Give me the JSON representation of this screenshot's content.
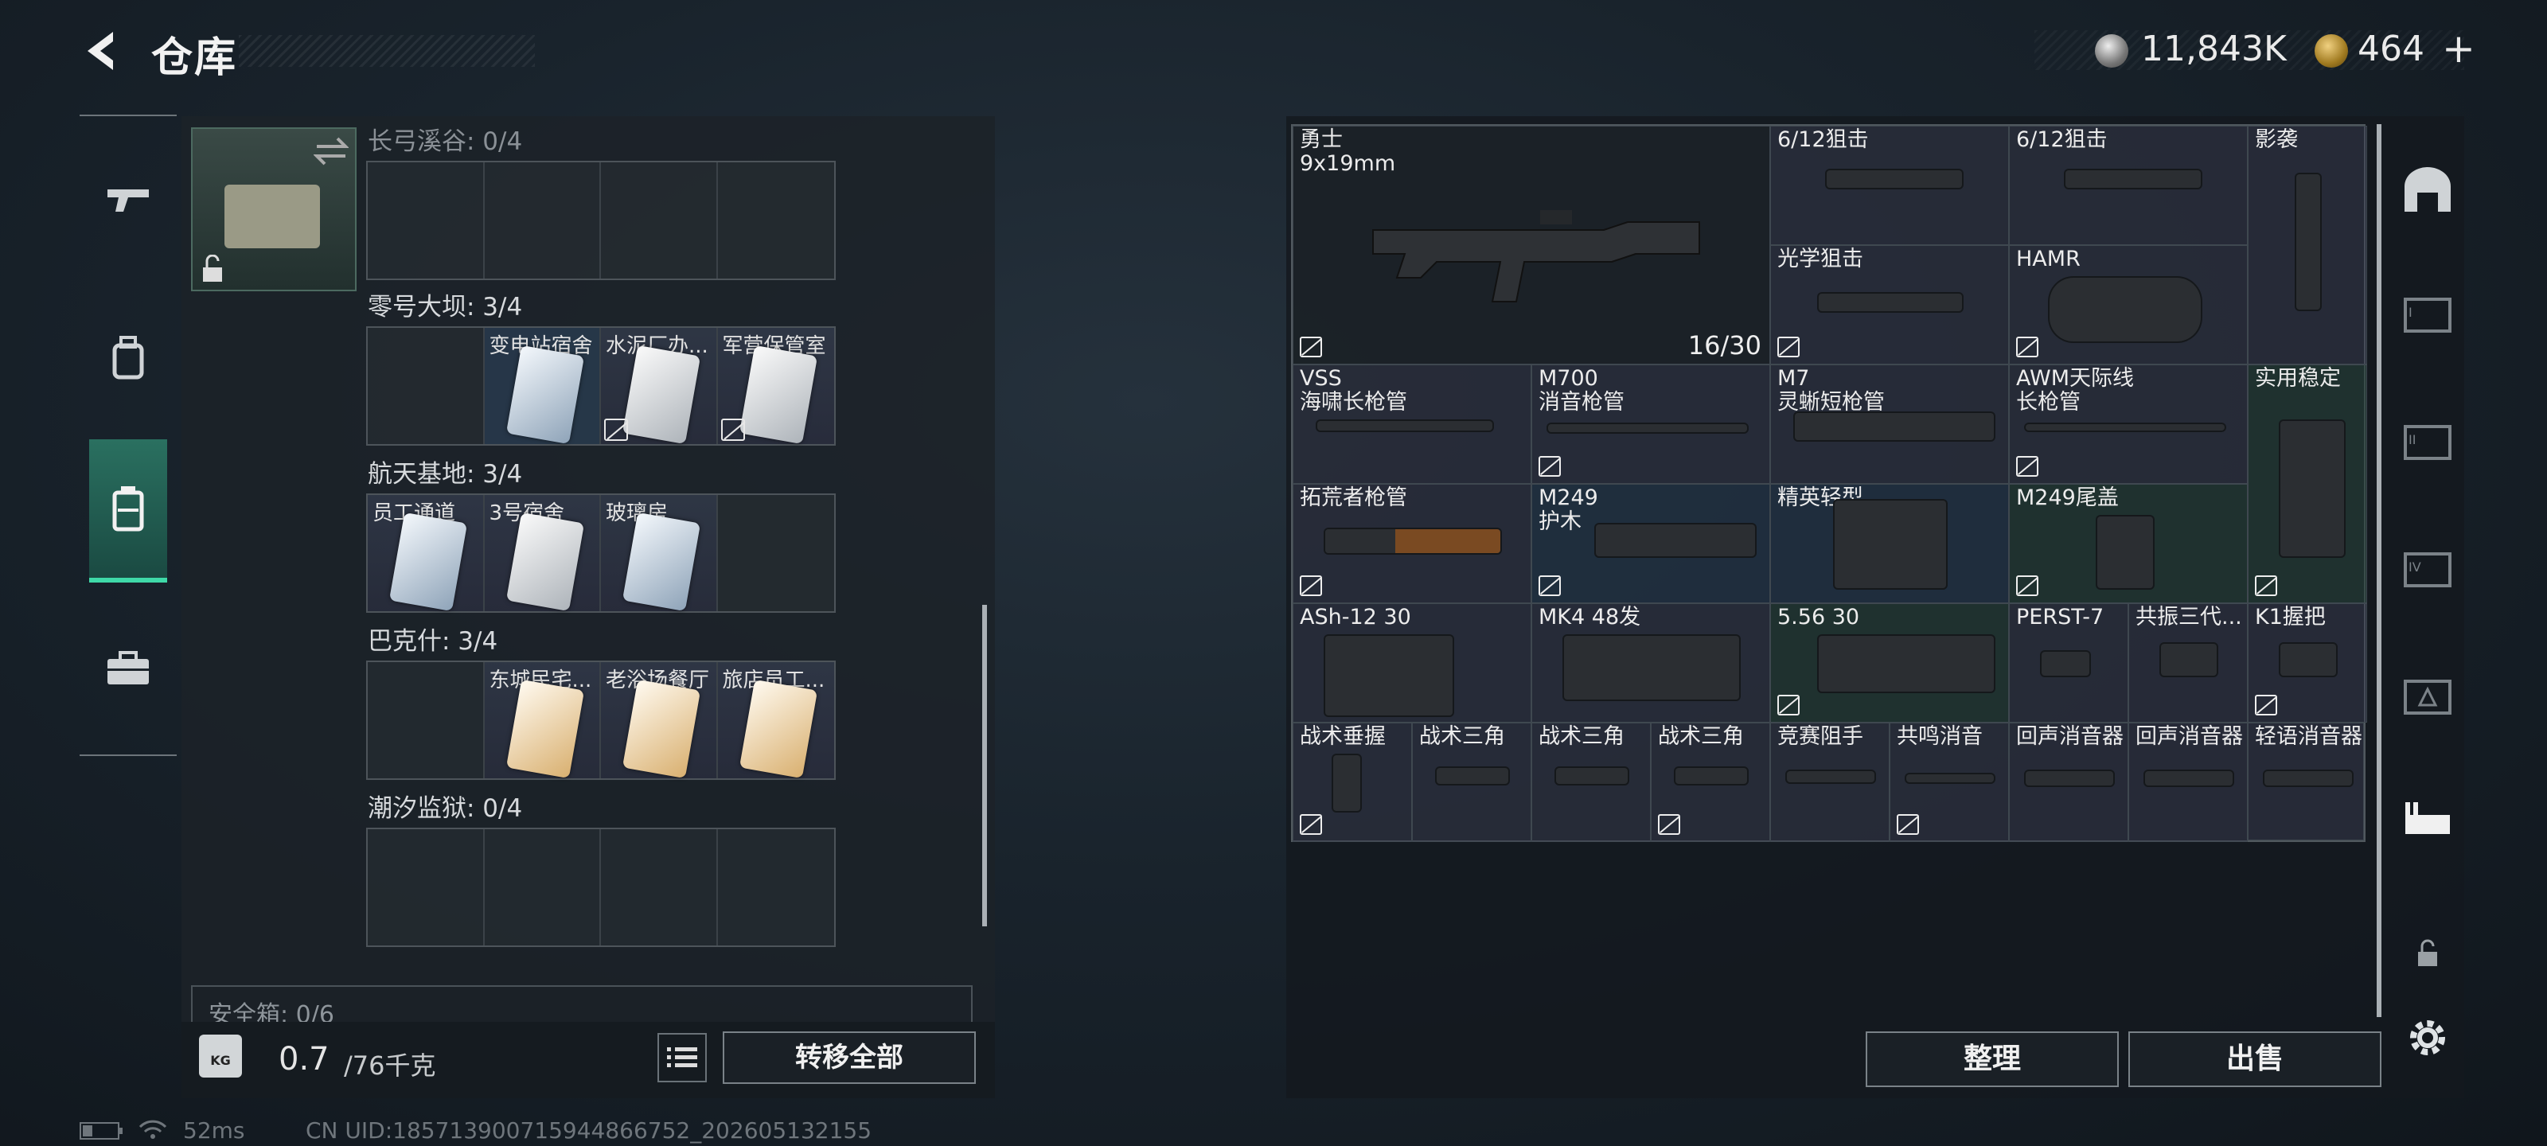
{
  "header": {
    "title": "仓库"
  },
  "currency": {
    "silver": "11,843K",
    "gold": "464",
    "plus": "+"
  },
  "left_panel": {
    "sections": [
      {
        "title": "长弓溪谷: 0/4",
        "cells": [
          {
            "label": ""
          },
          {
            "label": ""
          },
          {
            "label": ""
          },
          {
            "label": ""
          }
        ]
      },
      {
        "title": "零号大坝: 3/4",
        "cells": [
          {
            "label": ""
          },
          {
            "label": "变电站宿舍",
            "card": "blue",
            "locked": false
          },
          {
            "label": "水泥厂办...",
            "card": "white",
            "locked": true
          },
          {
            "label": "军营保管室",
            "card": "white",
            "locked": true
          }
        ]
      },
      {
        "title": "航天基地: 3/4",
        "cells": [
          {
            "label": "员工通道",
            "card": "blue"
          },
          {
            "label": "3号宿舍",
            "card": "white"
          },
          {
            "label": "玻璃房",
            "card": "blue"
          },
          {
            "label": ""
          }
        ]
      },
      {
        "title": "巴克什: 3/4",
        "cells": [
          {
            "label": ""
          },
          {
            "label": "东城民宅...",
            "card": "gold"
          },
          {
            "label": "老浴场餐厅",
            "card": "gold"
          },
          {
            "label": "旅店员工...",
            "card": "gold"
          }
        ]
      },
      {
        "title": "潮汐监狱: 0/4",
        "cells": [
          {
            "label": ""
          },
          {
            "label": ""
          },
          {
            "label": ""
          },
          {
            "label": ""
          }
        ]
      }
    ],
    "safebox_label": "安全箱: 0/6",
    "weight": "0.7",
    "weight_max": "/76千克",
    "weight_icon": "KG",
    "transfer_all": "转移全部"
  },
  "stash": {
    "items": [
      {
        "name": "勇士\n9x19mm",
        "count": "16/30"
      },
      {
        "name": "6/12狙击"
      },
      {
        "name": "6/12狙击"
      },
      {
        "name": "影袭"
      },
      {
        "name": "光学狙击"
      },
      {
        "name": "HAMR"
      },
      {
        "name": "VSS\n海啸长枪管"
      },
      {
        "name": "M700\n消音枪管"
      },
      {
        "name": "M7\n灵蜥短枪管"
      },
      {
        "name": "AWM天际线\n长枪管"
      },
      {
        "name": "实用稳定"
      },
      {
        "name": "拓荒者枪管"
      },
      {
        "name": "M249\n护木"
      },
      {
        "name": "精英轻型"
      },
      {
        "name": "M249尾盖"
      },
      {
        "name": "ASh-12 30"
      },
      {
        "name": "MK4 48发"
      },
      {
        "name": "5.56 30"
      },
      {
        "name": "PERST-7"
      },
      {
        "name": "共振三代..."
      },
      {
        "name": "K1握把"
      },
      {
        "name": "战术垂握"
      },
      {
        "name": "战术三角"
      },
      {
        "name": "战术三角"
      },
      {
        "name": "战术三角"
      },
      {
        "name": "竞赛阻手"
      },
      {
        "name": "共鸣消音"
      },
      {
        "name": "回声消音器"
      },
      {
        "name": "回声消音器"
      },
      {
        "name": "轻语消音器"
      }
    ],
    "sort": "整理",
    "sell": "出售"
  },
  "status": {
    "ping": "52ms",
    "uid": "CN UID:185713900715944866752_202605132155"
  }
}
